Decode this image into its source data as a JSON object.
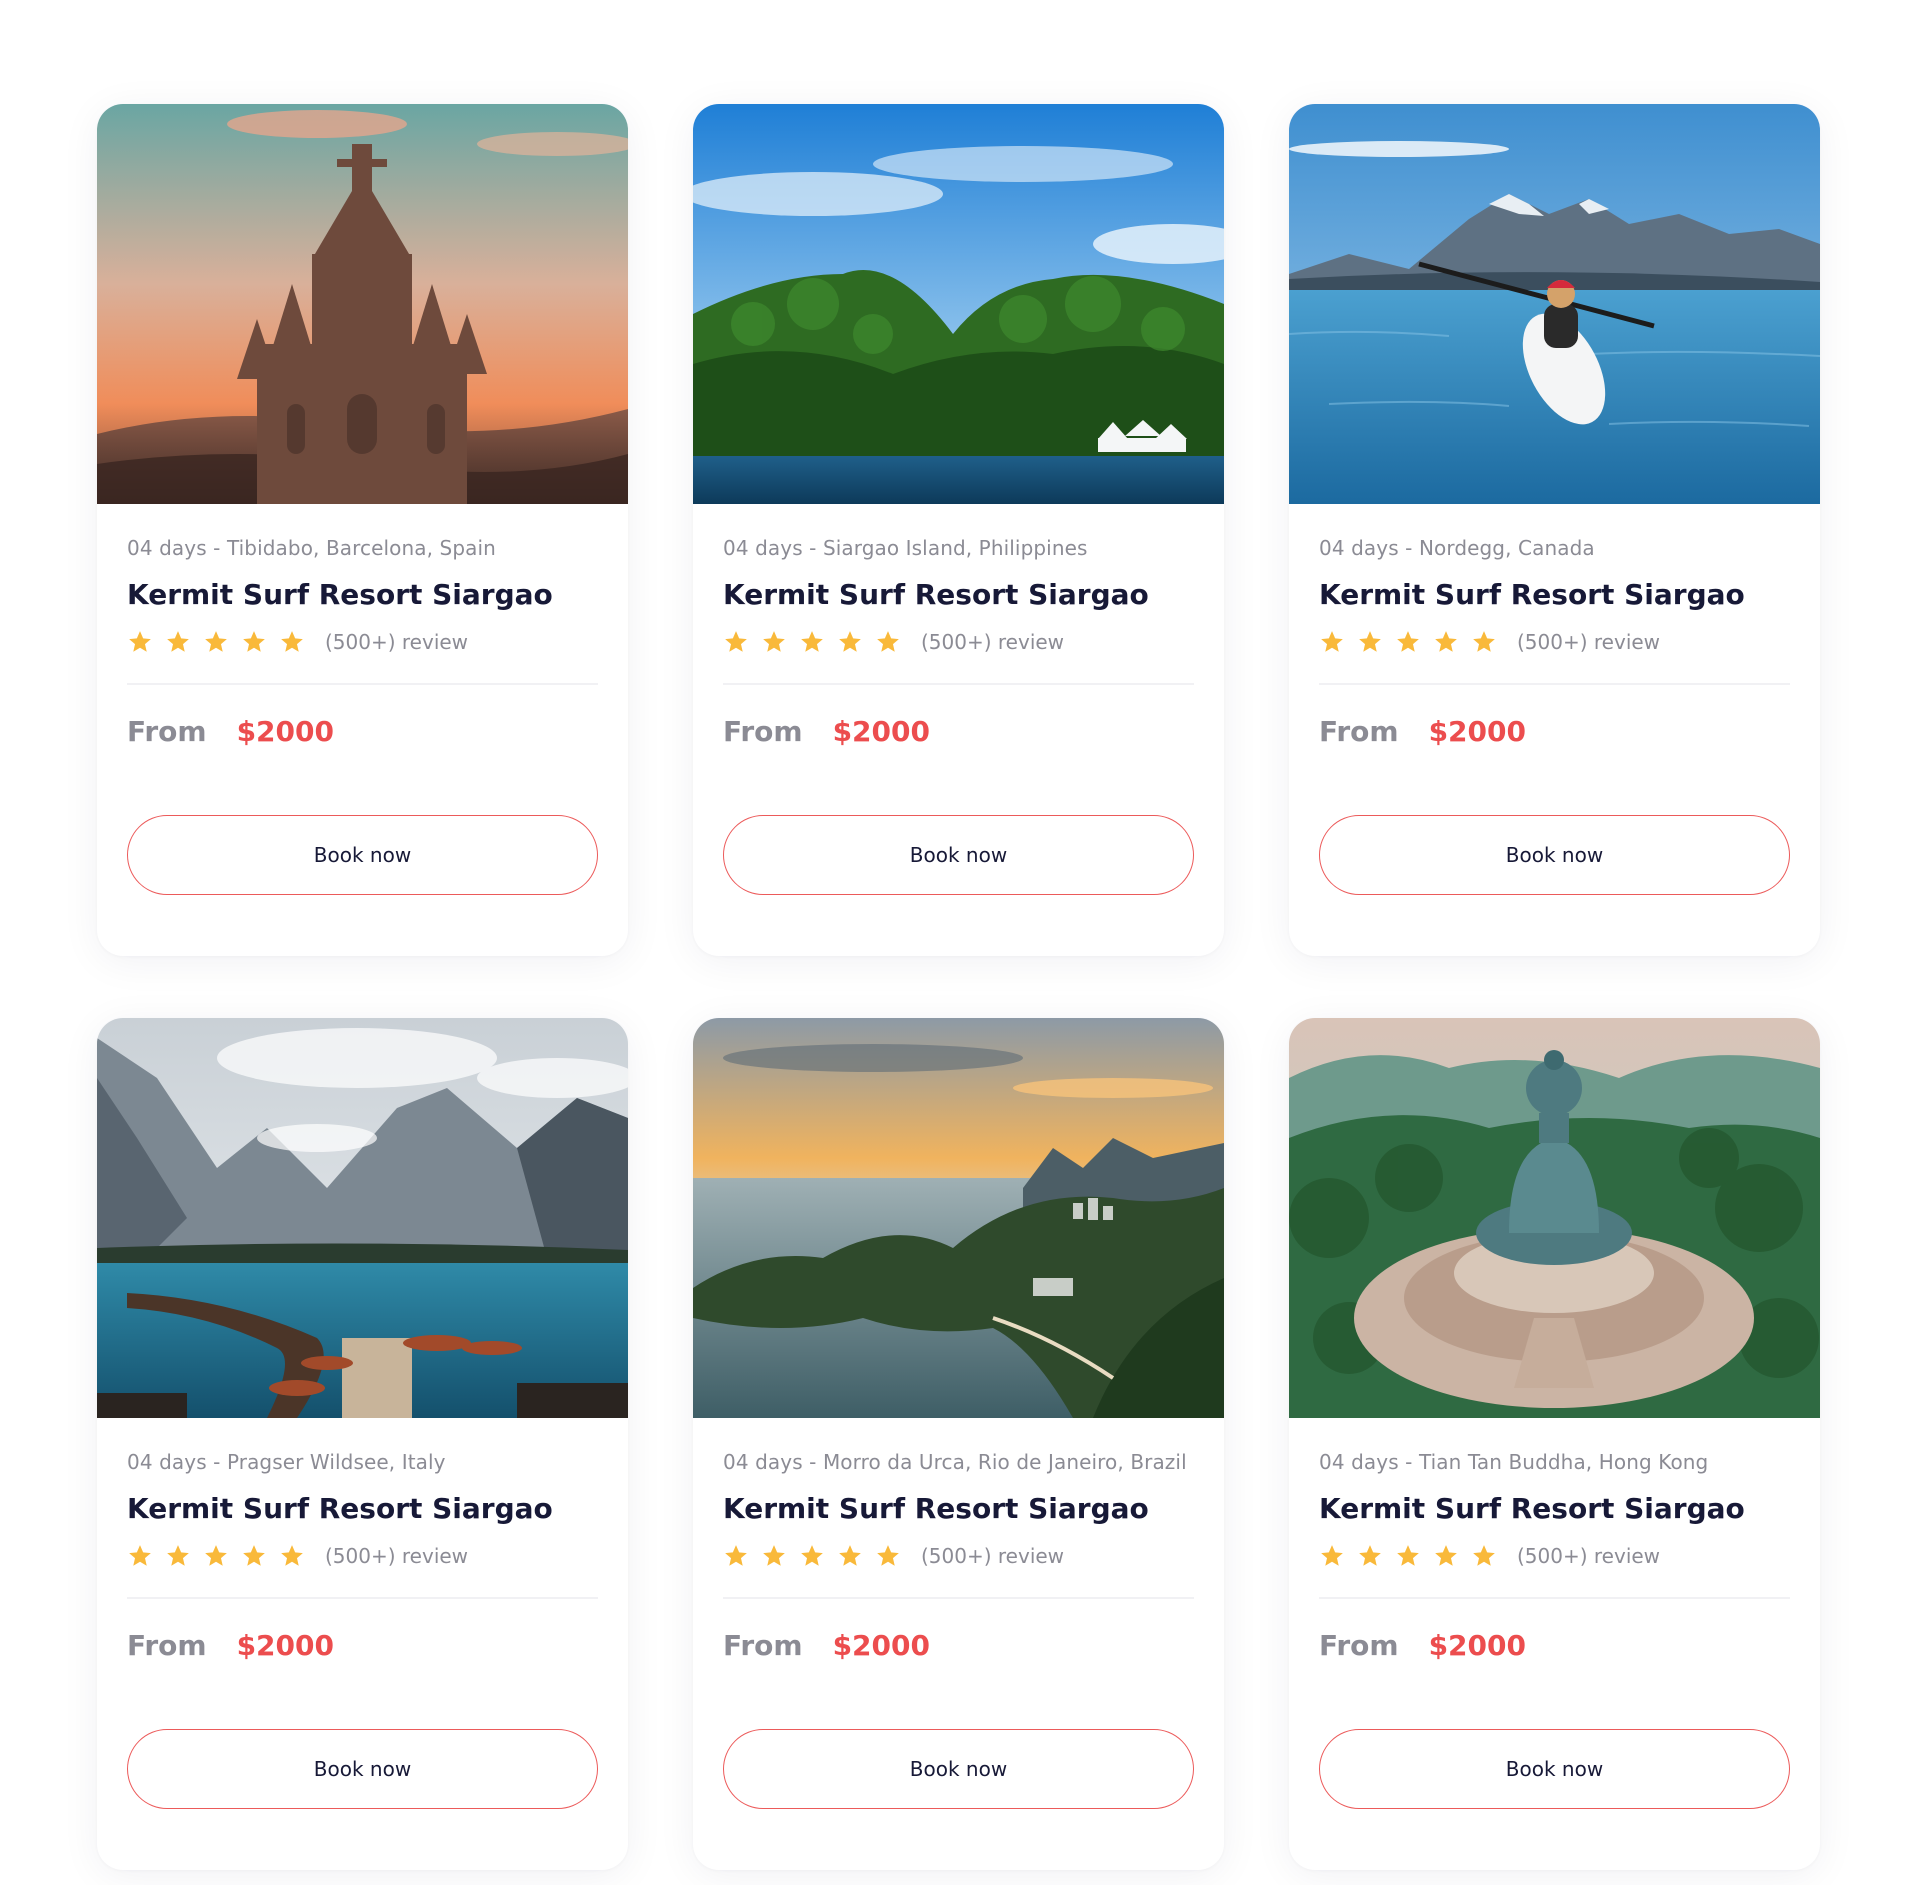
{
  "cards": [
    {
      "meta": "04 days - Tibidabo, Barcelona, Spain",
      "title": "Kermit Surf Resort Siargao",
      "review": "(500+) review",
      "rating": 5,
      "from_label": "From",
      "price": "$2000",
      "button": "Book now",
      "photo_subject": "gothic-church-sunset"
    },
    {
      "meta": "04 days - Siargao Island, Philippines",
      "title": "Kermit Surf Resort Siargao",
      "review": "(500+) review",
      "rating": 5,
      "from_label": "From",
      "price": "$2000",
      "button": "Book now",
      "photo_subject": "green-island-sea"
    },
    {
      "meta": "04 days - Nordegg, Canada",
      "title": "Kermit Surf Resort Siargao",
      "review": "(500+) review",
      "rating": 5,
      "from_label": "From",
      "price": "$2000",
      "button": "Book now",
      "photo_subject": "kayak-mountain-lake"
    },
    {
      "meta": "04 days - Pragser Wildsee, Italy",
      "title": "Kermit Surf Resort Siargao",
      "review": "(500+) review",
      "rating": 5,
      "from_label": "From",
      "price": "$2000",
      "button": "Book now",
      "photo_subject": "alpine-lake-boats"
    },
    {
      "meta": "04 days - Morro da Urca, Rio de Janeiro, Brazil",
      "title": "Kermit Surf Resort Siargao",
      "review": "(500+) review",
      "rating": 5,
      "from_label": "From",
      "price": "$2000",
      "button": "Book now",
      "photo_subject": "coastal-city-sunset"
    },
    {
      "meta": "04 days - Tian Tan Buddha, Hong Kong",
      "title": "Kermit Surf Resort Siargao",
      "review": "(500+) review",
      "rating": 5,
      "from_label": "From",
      "price": "$2000",
      "button": "Book now",
      "photo_subject": "buddha-statue-hills"
    }
  ],
  "colors": {
    "title": "#171937",
    "muted": "#8b8b94",
    "price": "#ec4d4e",
    "button_border": "#ec5a5a",
    "star": "#f9b93a"
  }
}
